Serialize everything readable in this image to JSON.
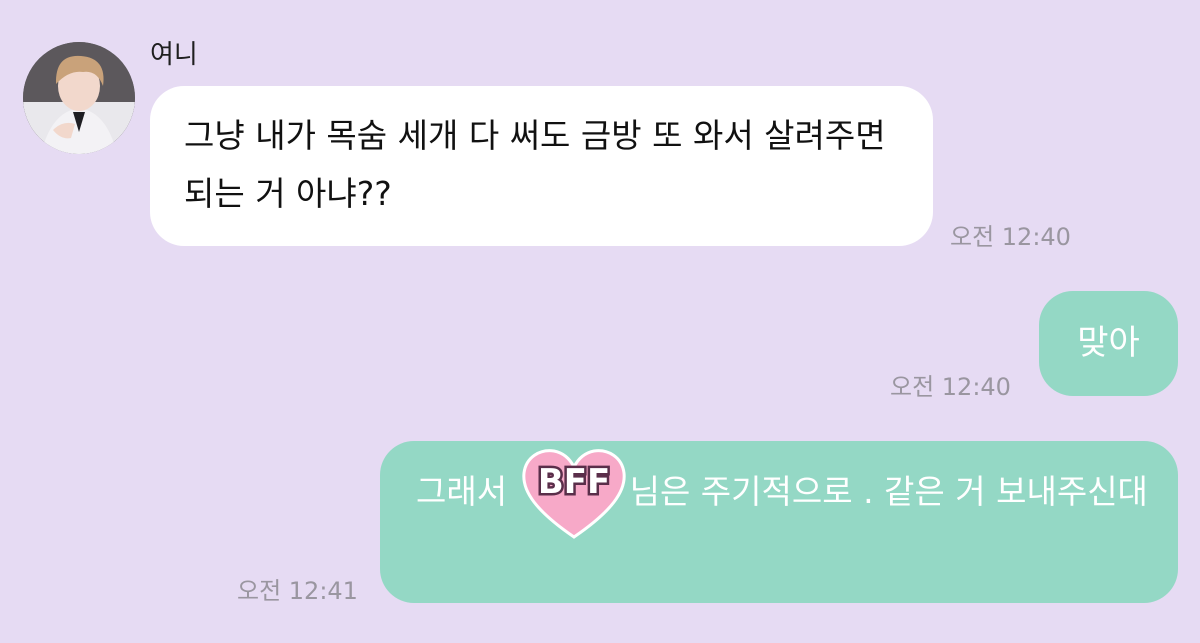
{
  "chat": {
    "contact_name": "여니",
    "messages": [
      {
        "from": "contact",
        "text": "그냥 내가 목숨 세개 다 써도 금방 또 와서 살려주면 되는 거 아냐??",
        "time": "오전 12:40"
      },
      {
        "from": "me",
        "text": "맞아",
        "time": "오전 12:40"
      },
      {
        "from": "me",
        "text_before": "그래서 ",
        "sticker_label": "BFF",
        "text_after": "님은 주기적으로 . 같은 거 보내주신대",
        "time": "오전 12:41"
      }
    ]
  },
  "colors": {
    "background": "#e6dbf3",
    "incoming_bubble": "#ffffff",
    "outgoing_bubble": "#94d8c5",
    "timestamp": "#9a96a0",
    "sticker_heart": "#f7a9c8"
  },
  "icons": {
    "avatar": "profile-photo",
    "sticker": "bff-heart-sticker"
  }
}
